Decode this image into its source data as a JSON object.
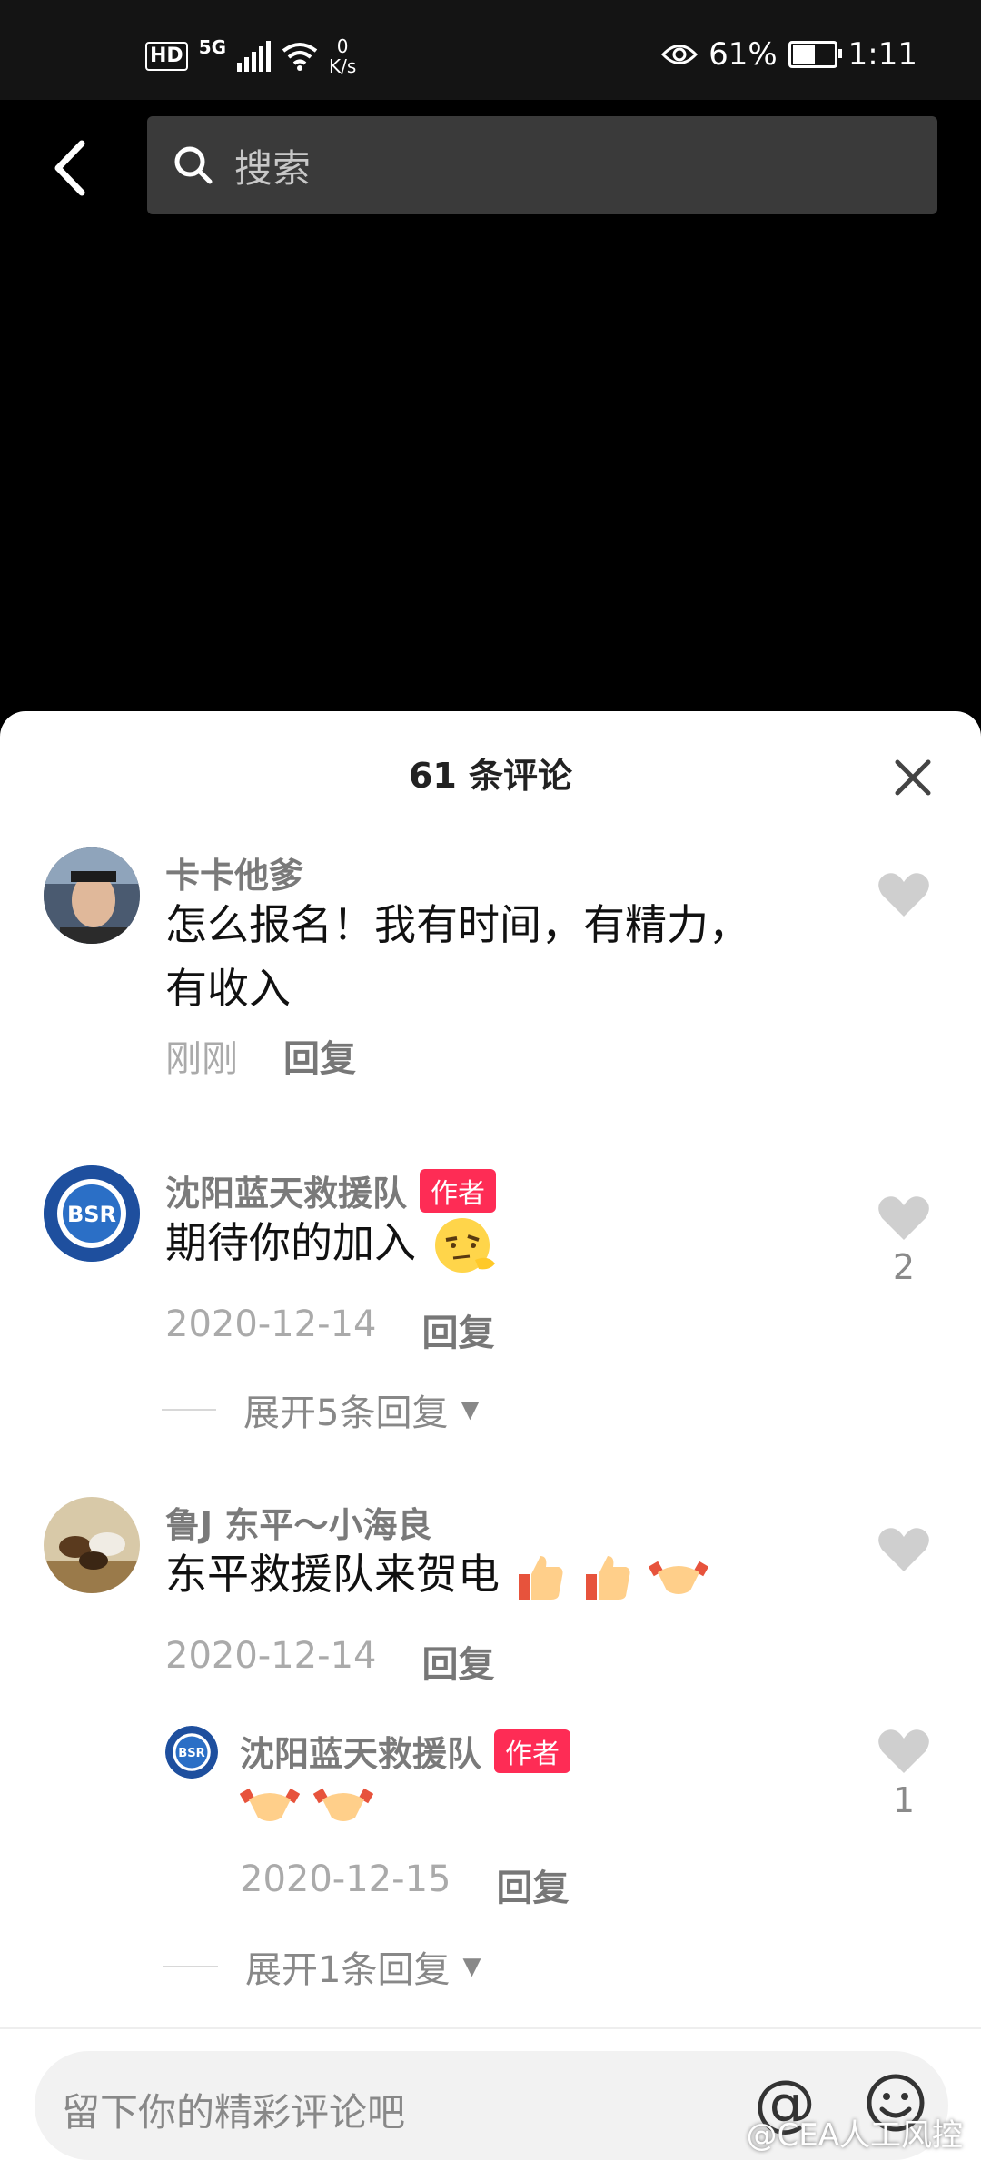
{
  "status_bar": {
    "hd": "HD",
    "network": "5G",
    "speed_value": "0",
    "speed_unit": "K/s",
    "battery_percent": "61%",
    "battery_level": 0.61,
    "time": "1:11"
  },
  "nav": {
    "search_placeholder": "搜索"
  },
  "sheet": {
    "title": "61 条评论"
  },
  "comments": [
    {
      "username": "卡卡他爹",
      "text_line1": "怎么报名！我有时间，有精力，",
      "text_line2": "有收入",
      "time": "刚刚",
      "reply_label": "回复",
      "likes": ""
    },
    {
      "username": "沈阳蓝天救援队",
      "badge": "作者",
      "text": "期待你的加入",
      "time": "2020-12-14",
      "reply_label": "回复",
      "likes": "2",
      "expand": "展开5条回复"
    },
    {
      "username": "鲁J 东平～小海良",
      "text": "东平救援队来贺电",
      "time": "2020-12-14",
      "reply_label": "回复",
      "likes": ""
    },
    {
      "username": "沈阳蓝天救援队",
      "badge": "作者",
      "text": "",
      "time": "2020-12-15",
      "reply_label": "回复",
      "likes": "1",
      "expand": "展开1条回复"
    }
  ],
  "input": {
    "placeholder": "留下你的精彩评论吧",
    "at_symbol": "@"
  },
  "watermark": "@CEA人工风控",
  "logo_text": "BSR",
  "colors": {
    "author_badge": "#fe2c55",
    "sheet_bg": "#ffffff",
    "search_bg": "#3a3a3a"
  }
}
